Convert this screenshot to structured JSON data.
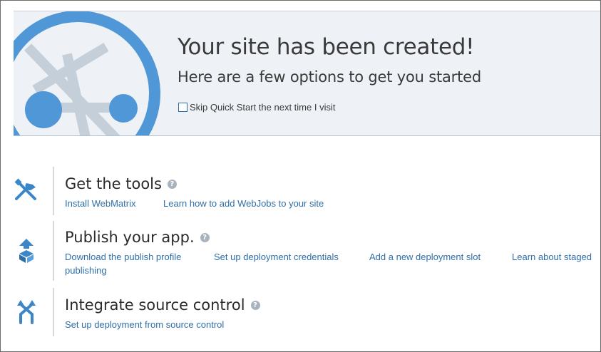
{
  "banner": {
    "title": "Your site has been created!",
    "subtitle": "Here are a few options to get you started",
    "skip_checkbox_checked": false,
    "skip_label": "Skip Quick Start the next time I visit"
  },
  "sections": [
    {
      "title": "Get the tools",
      "icon": "tools-icon",
      "links": [
        "Install WebMatrix",
        "Learn how to add WebJobs to your site"
      ]
    },
    {
      "title": "Publish your app.",
      "icon": "publish-icon",
      "links": [
        "Download the publish profile",
        "Set up deployment credentials",
        "Add a new deployment slot",
        "Learn about staged",
        "publishing"
      ]
    },
    {
      "title": "Integrate source control",
      "icon": "source-control-icon",
      "links": [
        "Set up deployment from source control"
      ]
    }
  ],
  "colors": {
    "accent": "#4a90d0",
    "link": "#2f6fa8",
    "banner_bg": "#eef2f6"
  }
}
